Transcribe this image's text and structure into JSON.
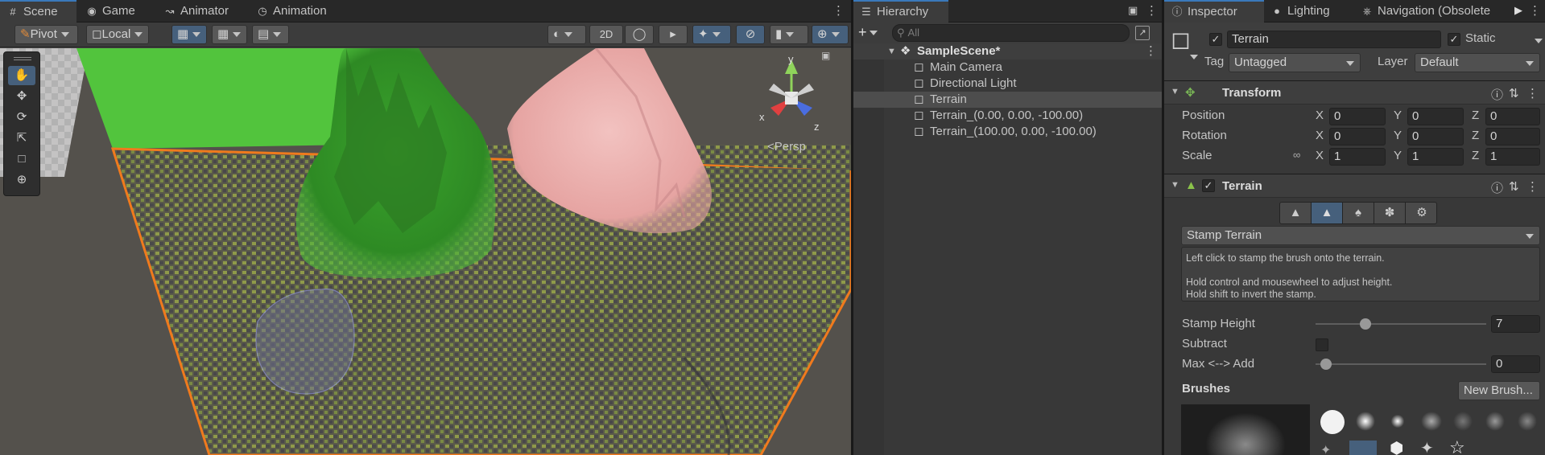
{
  "scene_panel": {
    "tabs": [
      {
        "label": "Scene",
        "icon": "grid-icon"
      },
      {
        "label": "Game",
        "icon": "gamepad-icon"
      },
      {
        "label": "Animator",
        "icon": "animator-icon"
      },
      {
        "label": "Animation",
        "icon": "clock-icon"
      }
    ],
    "toolbar": {
      "pivot": "Pivot",
      "local": "Local",
      "mode_2d": "2D"
    },
    "tools": [
      "hand-tool-icon",
      "move-tool-icon",
      "rotate-tool-icon",
      "scale-tool-icon",
      "rect-tool-icon",
      "transform-tool-icon"
    ],
    "gizmo": {
      "y": "y",
      "x": "x",
      "z": "z",
      "persp": "Persp"
    }
  },
  "hierarchy": {
    "tab": "Hierarchy",
    "search_placeholder": "All",
    "scene_name": "SampleScene*",
    "items": [
      "Main Camera",
      "Directional Light",
      "Terrain",
      "Terrain_(0.00, 0.00, -100.00)",
      "Terrain_(100.00, 0.00, -100.00)"
    ],
    "selected_index": 2
  },
  "inspector": {
    "tabs": [
      {
        "label": "Inspector",
        "icon": "info-icon"
      },
      {
        "label": "Lighting",
        "icon": "bulb-icon"
      },
      {
        "label": "Navigation (Obsolete",
        "icon": "navigation-icon"
      }
    ],
    "object_name": "Terrain",
    "static_label": "Static",
    "tag_label": "Tag",
    "tag_value": "Untagged",
    "layer_label": "Layer",
    "layer_value": "Default",
    "transform": {
      "title": "Transform",
      "position_label": "Position",
      "rotation_label": "Rotation",
      "scale_label": "Scale",
      "position": {
        "x": "0",
        "y": "0",
        "z": "0"
      },
      "rotation": {
        "x": "0",
        "y": "0",
        "z": "0"
      },
      "scale": {
        "x": "1",
        "y": "1",
        "z": "1"
      },
      "axis_x": "X",
      "axis_y": "Y",
      "axis_z": "Z"
    },
    "terrain": {
      "title": "Terrain",
      "tool_dropdown": "Stamp Terrain",
      "help_line1": "Left click to stamp the brush onto the terrain.",
      "help_line2": "Hold control and mousewheel to adjust height.",
      "help_line3": "Hold shift to invert the stamp.",
      "stamp_height_label": "Stamp Height",
      "stamp_height_value": "7",
      "stamp_height_fraction": 0.28,
      "subtract_label": "Subtract",
      "max_add_label": "Max <--> Add",
      "max_add_value": "0",
      "max_add_fraction": 0.03,
      "brushes_label": "Brushes",
      "new_brush_label": "New Brush..."
    }
  },
  "colors": {
    "accent": "#3a79bb",
    "selection_orange": "#f07a1d",
    "green_mountain": "#4ab83a",
    "pink_mountain": "#e9a7a5",
    "ground": "#54514c"
  }
}
